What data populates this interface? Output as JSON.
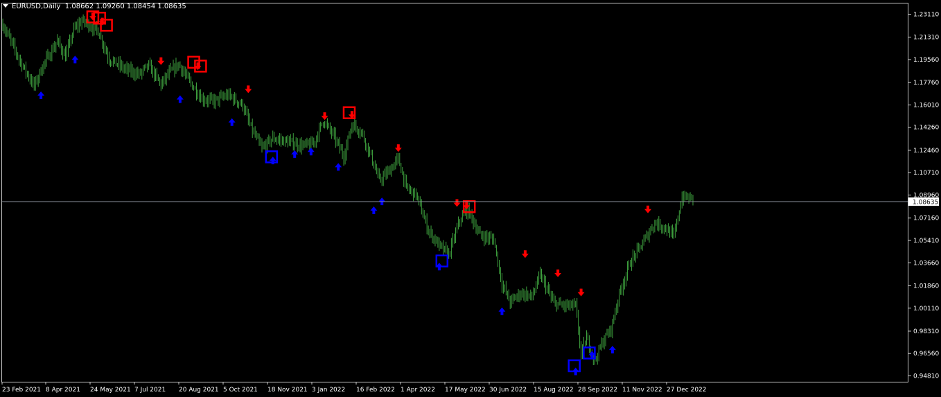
{
  "header": {
    "symbol": "EURUSD,Daily",
    "ohlc": "1.08662 1.09260 1.08454 1.08635"
  },
  "colors": {
    "background": "#000000",
    "bars": "#3ea13e",
    "grid_border": "#c8c8c8",
    "bid_line": "#8a8f9a",
    "arrow_down": "#ff0000",
    "arrow_up": "#0000ff",
    "label_bg": "#ffffff",
    "label_text": "#000000"
  },
  "chart_data": {
    "type": "ohlc",
    "symbol": "EURUSD",
    "timeframe": "Daily",
    "current_price": 1.08635,
    "current_price_label": "1.08635",
    "ylim": [
      0.9435,
      1.2395
    ],
    "y_ticks": [
      "1.23110",
      "1.21310",
      "1.19560",
      "1.17760",
      "1.16010",
      "1.14260",
      "1.12460",
      "1.10710",
      "1.08960",
      "1.07160",
      "1.05410",
      "1.03660",
      "1.01860",
      "1.00110",
      "0.98310",
      "0.96560",
      "0.94810"
    ],
    "x_ticks": [
      "23 Feb 2021",
      "8 Apr 2021",
      "24 May 2021",
      "7 Jul 2021",
      "20 Aug 2021",
      "5 Oct 2021",
      "18 Nov 2021",
      "3 Jan 2022",
      "16 Feb 2022",
      "1 Apr 2022",
      "17 May 2022",
      "30 Jun 2022",
      "15 Aug 2022",
      "28 Sep 2022",
      "11 Nov 2022",
      "27 Dec 2022"
    ],
    "path_keypoints": [
      [
        0,
        1.223
      ],
      [
        5,
        1.212
      ],
      [
        12,
        1.196
      ],
      [
        16,
        1.188
      ],
      [
        23,
        1.175
      ],
      [
        30,
        1.192
      ],
      [
        40,
        1.21
      ],
      [
        46,
        1.198
      ],
      [
        52,
        1.219
      ],
      [
        58,
        1.226
      ],
      [
        64,
        1.222
      ],
      [
        70,
        1.218
      ],
      [
        78,
        1.196
      ],
      [
        90,
        1.188
      ],
      [
        100,
        1.184
      ],
      [
        107,
        1.191
      ],
      [
        116,
        1.176
      ],
      [
        122,
        1.185
      ],
      [
        129,
        1.192
      ],
      [
        136,
        1.18
      ],
      [
        146,
        1.165
      ],
      [
        155,
        1.163
      ],
      [
        165,
        1.168
      ],
      [
        176,
        1.16
      ],
      [
        182,
        1.142
      ],
      [
        190,
        1.126
      ],
      [
        198,
        1.134
      ],
      [
        210,
        1.131
      ],
      [
        220,
        1.128
      ],
      [
        228,
        1.13
      ],
      [
        235,
        1.148
      ],
      [
        242,
        1.137
      ],
      [
        250,
        1.12
      ],
      [
        256,
        1.145
      ],
      [
        263,
        1.139
      ],
      [
        270,
        1.12
      ],
      [
        276,
        1.101
      ],
      [
        283,
        1.108
      ],
      [
        290,
        1.118
      ],
      [
        296,
        1.095
      ],
      [
        303,
        1.09
      ],
      [
        312,
        1.062
      ],
      [
        320,
        1.05
      ],
      [
        327,
        1.043
      ],
      [
        335,
        1.07
      ],
      [
        341,
        1.078
      ],
      [
        350,
        1.058
      ],
      [
        360,
        1.055
      ],
      [
        366,
        1.02
      ],
      [
        372,
        1.006
      ],
      [
        380,
        1.013
      ],
      [
        388,
        1.01
      ],
      [
        394,
        1.027
      ],
      [
        404,
        1.005
      ],
      [
        412,
        1.003
      ],
      [
        420,
        1.003
      ],
      [
        424,
        0.965
      ],
      [
        428,
        0.978
      ],
      [
        434,
        0.96
      ],
      [
        440,
        0.975
      ],
      [
        446,
        0.985
      ],
      [
        452,
        1.012
      ],
      [
        460,
        1.037
      ],
      [
        468,
        1.05
      ],
      [
        478,
        1.068
      ],
      [
        486,
        1.064
      ],
      [
        492,
        1.057
      ],
      [
        498,
        1.088
      ],
      [
        506,
        1.087
      ]
    ],
    "signals_down": [
      [
        66,
        1.228
      ],
      [
        73,
        1.224
      ],
      [
        116,
        1.193
      ],
      [
        143,
        1.189
      ],
      [
        180,
        1.171
      ],
      [
        236,
        1.15
      ],
      [
        256,
        1.151
      ],
      [
        290,
        1.125
      ],
      [
        333,
        1.082
      ],
      [
        340,
        1.08
      ],
      [
        383,
        1.042
      ],
      [
        407,
        1.027
      ],
      [
        424,
        1.012
      ],
      [
        473,
        1.077
      ]
    ],
    "signals_up": [
      [
        28,
        1.169
      ],
      [
        53,
        1.197
      ],
      [
        130,
        1.166
      ],
      [
        168,
        1.148
      ],
      [
        198,
        1.118
      ],
      [
        214,
        1.123
      ],
      [
        226,
        1.125
      ],
      [
        246,
        1.113
      ],
      [
        272,
        1.079
      ],
      [
        278,
        1.086
      ],
      [
        320,
        1.035
      ],
      [
        366,
        1.0
      ],
      [
        420,
        0.953
      ],
      [
        432,
        0.966
      ],
      [
        447,
        0.97
      ]
    ],
    "signal_boxes": [
      {
        "kind": "sell",
        "i": 66,
        "y": 1.229
      },
      {
        "kind": "sell",
        "i": 71,
        "y": 1.228
      },
      {
        "kind": "sell",
        "i": 76,
        "y": 1.2225
      },
      {
        "kind": "sell",
        "i": 140,
        "y": 1.1935
      },
      {
        "kind": "sell",
        "i": 145,
        "y": 1.1905
      },
      {
        "kind": "sell",
        "i": 254,
        "y": 1.154
      },
      {
        "kind": "sell",
        "i": 342,
        "y": 1.0805
      },
      {
        "kind": "buy",
        "i": 197,
        "y": 1.1195
      },
      {
        "kind": "buy",
        "i": 322,
        "y": 1.038
      },
      {
        "kind": "buy",
        "i": 419,
        "y": 0.956
      },
      {
        "kind": "buy",
        "i": 430,
        "y": 0.966
      }
    ]
  }
}
